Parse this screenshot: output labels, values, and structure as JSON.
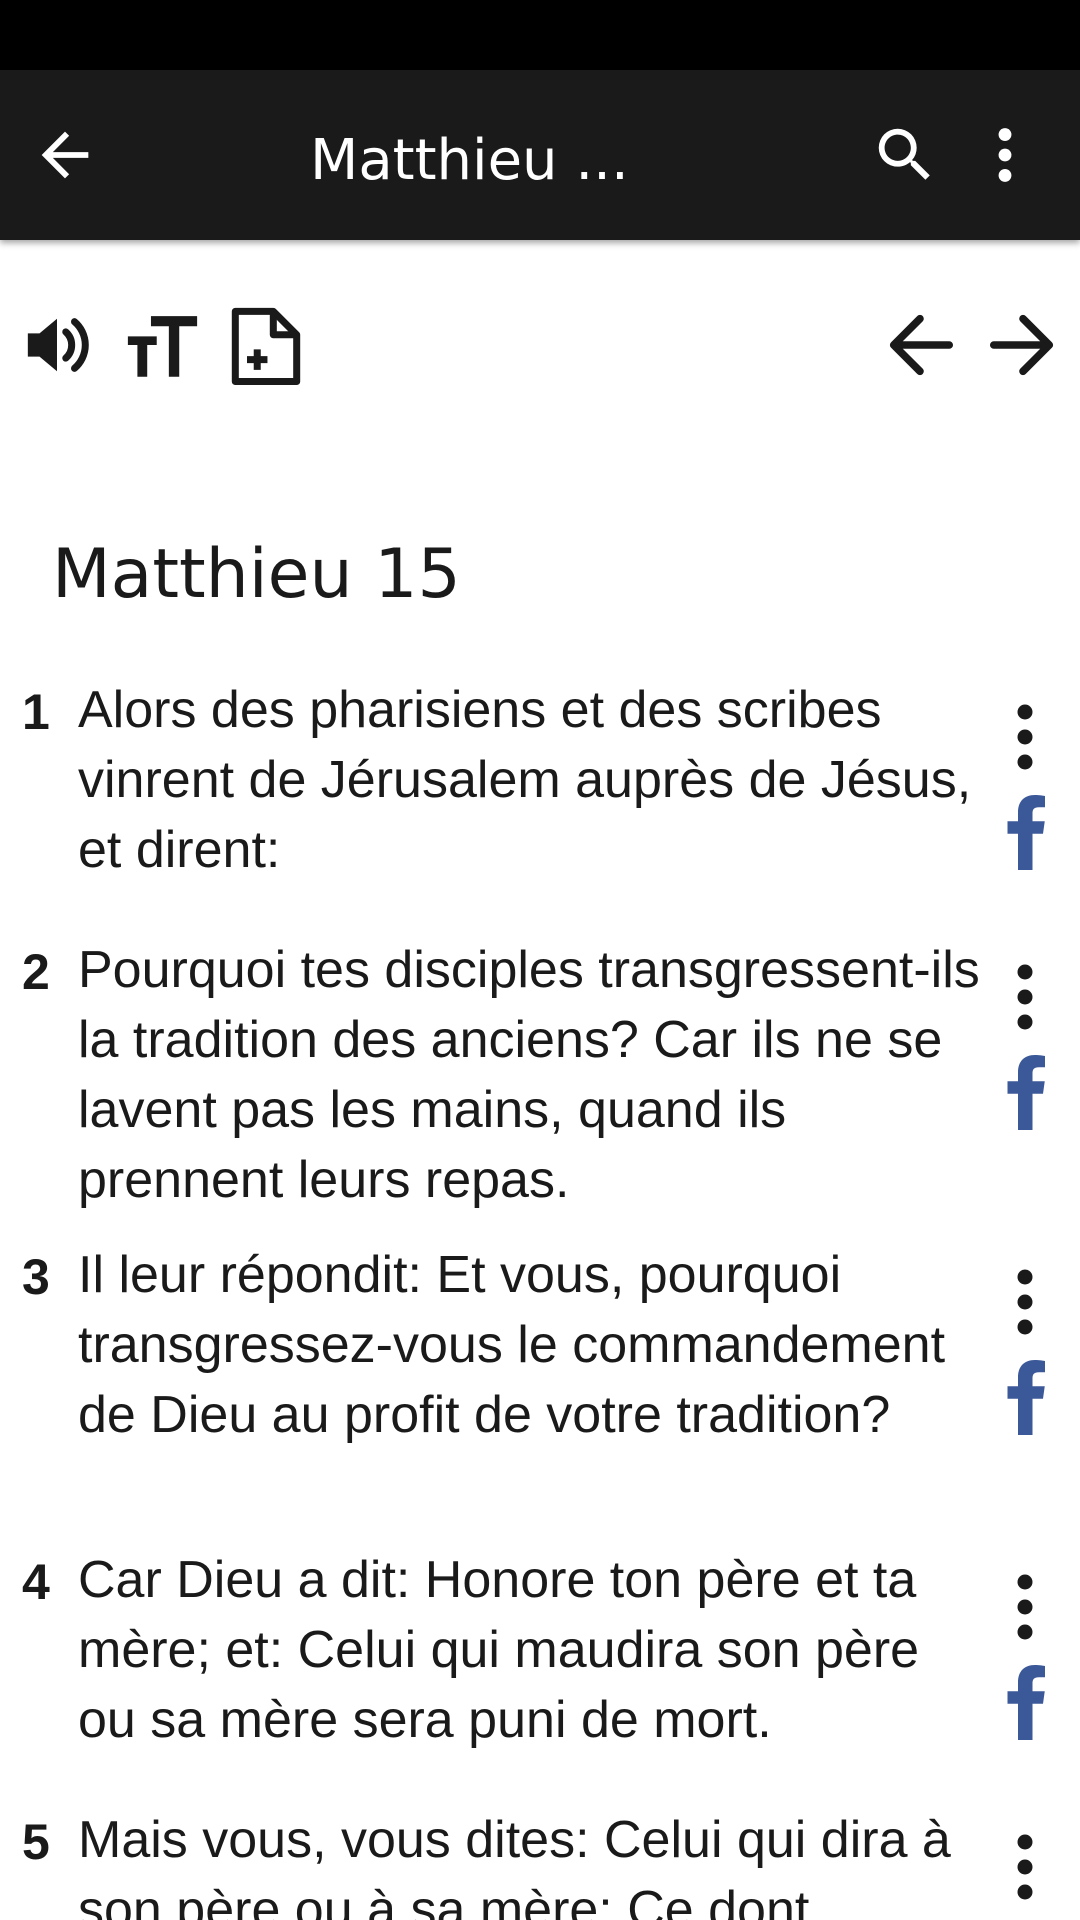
{
  "app_bar": {
    "title": "Matthieu ...",
    "back_icon": "arrow-left-icon",
    "search_icon": "search-icon",
    "more_icon": "more-vertical-icon"
  },
  "toolbar": {
    "icons": [
      "speaker-icon",
      "text-size-icon",
      "add-note-icon",
      "previous-chapter-icon",
      "next-chapter-icon"
    ]
  },
  "chapter": {
    "title": "Matthieu 15"
  },
  "verses": [
    {
      "number": "1",
      "text": "Alors des pharisiens et des scribes vinrent de Jérusalem auprès de Jésus, et dirent:"
    },
    {
      "number": "2",
      "text": "Pourquoi tes disciples transgressent-ils la tradition des anciens? Car ils ne se lavent pas les mains, quand ils prennent leurs repas."
    },
    {
      "number": "3",
      "text": "Il leur répondit: Et vous, pourquoi transgressez-vous le commandement de Dieu au profit de votre tradition?"
    },
    {
      "number": "4",
      "text": "Car Dieu a dit: Honore ton père et ta mère; et: Celui qui maudira son père ou sa mère sera puni de mort."
    },
    {
      "number": "5",
      "text": "Mais vous, vous dites: Celui qui dira à son père ou à sa mère: Ce dont"
    }
  ],
  "colors": {
    "status_bar": "#000000",
    "app_bar": "#1a1a1a",
    "text": "#1a1a1a",
    "facebook": "#3b5998"
  }
}
